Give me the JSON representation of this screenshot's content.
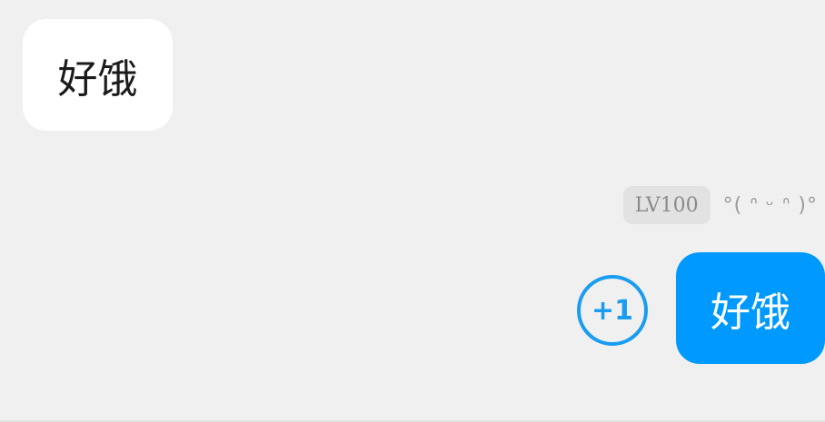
{
  "incoming": {
    "text": "好饿"
  },
  "outgoing": {
    "level_badge": "LV100",
    "nickname": "°( ᐢ ᵕ ᐢ )°",
    "plus_one_label": "+1",
    "text": "好饿"
  },
  "colors": {
    "background": "#f0f0f0",
    "incoming_bubble": "#ffffff",
    "outgoing_bubble": "#0099ff",
    "plus_one_accent": "#1a9cf0",
    "badge_bg": "#e2e2e2"
  }
}
